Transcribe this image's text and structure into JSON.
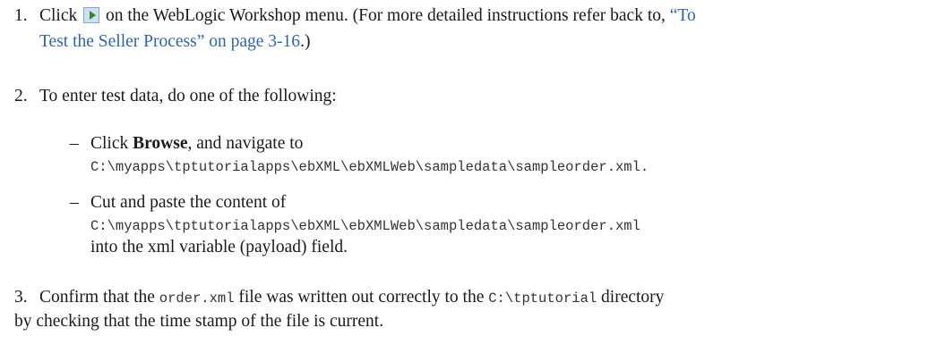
{
  "step1": {
    "number": "1.",
    "before_icon": "Click",
    "icon": "run-icon",
    "after_icon": "on the WebLogic Workshop menu. (For more detailed instructions refer back to,",
    "link_part1": "“To",
    "link_part2": "Test the Seller Process” on page 3-16",
    "end": ".)"
  },
  "step2": {
    "number": "2.",
    "text": "To enter test data, do one of the following:",
    "items": [
      {
        "dash": "–",
        "before_bold": "Click",
        "bold": "Browse",
        "after_bold": ", and navigate to",
        "path": "C:\\myapps\\tptutorialapps\\ebXML\\ebXMLWeb\\sampledata\\sampleorder.xml."
      },
      {
        "dash": "–",
        "text": "Cut and paste the content of",
        "path": "C:\\myapps\\tptutorialapps\\ebXML\\ebXMLWeb\\sampledata\\sampleorder.xml",
        "after_path": "into the xml variable (payload) field."
      }
    ]
  },
  "step3": {
    "number": "3.",
    "text1": "Confirm that the",
    "code1": "order.xml",
    "text2": "file was written out correctly to the",
    "code2": "C:\\tptutorial",
    "text3": "directory",
    "line2": "by checking that the time stamp of the file is current."
  }
}
